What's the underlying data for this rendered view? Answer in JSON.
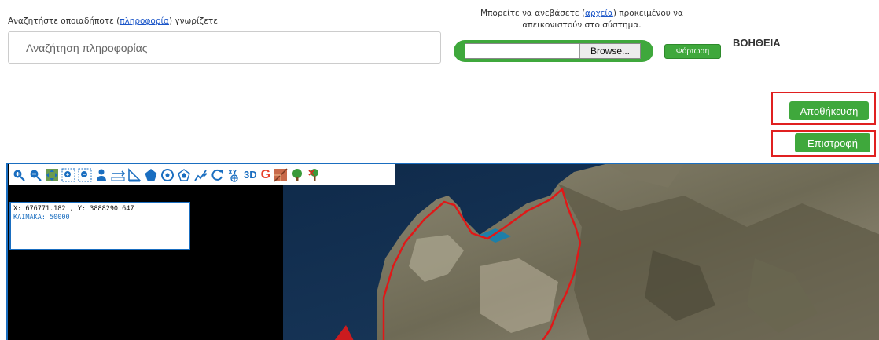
{
  "search": {
    "intro_prefix": "Αναζητήστε οποιαδήποτε (",
    "intro_link": "πληροφορία",
    "intro_suffix": ") γνωρίζετε",
    "placeholder": "Αναζήτηση πληροφορίας"
  },
  "upload": {
    "intro_prefix": "Μπορείτε να ανεβάσετε (",
    "intro_link": "αρχεία",
    "intro_suffix": ") προκειμένου να απεικονιστούν στο σύστημα.",
    "browse_label": "Browse...",
    "upload_label": "Φόρτωση"
  },
  "help_label": "ΒΟΗΘΕΙΑ",
  "actions": {
    "save_label": "Αποθήκευση",
    "back_label": "Επιστροφή"
  },
  "map": {
    "coords": "X: 676771.182 , Y: 3888290.647",
    "scale": "ΚΛΙΜΑΚΑ: 50000",
    "toolbar_3d": "3D",
    "toolbar_google": "G",
    "tools": [
      "zoom-in-icon",
      "zoom-out-icon",
      "pan-icon",
      "zoom-box-in-icon",
      "zoom-box-out-icon",
      "street-view-icon",
      "measure-line-icon",
      "measure-area-icon",
      "polygon-icon",
      "circle-icon",
      "buffer-icon",
      "draw-icon",
      "refresh-icon",
      "goto-xy-icon",
      "3d-view-icon",
      "google-icon",
      "cadastre-icon",
      "tree-icon",
      "forest-icon"
    ]
  },
  "colors": {
    "accent_green": "#3fa83c",
    "highlight_red": "#e02020",
    "map_border_blue": "#1a6ec0",
    "boundary_red": "#e01818"
  }
}
